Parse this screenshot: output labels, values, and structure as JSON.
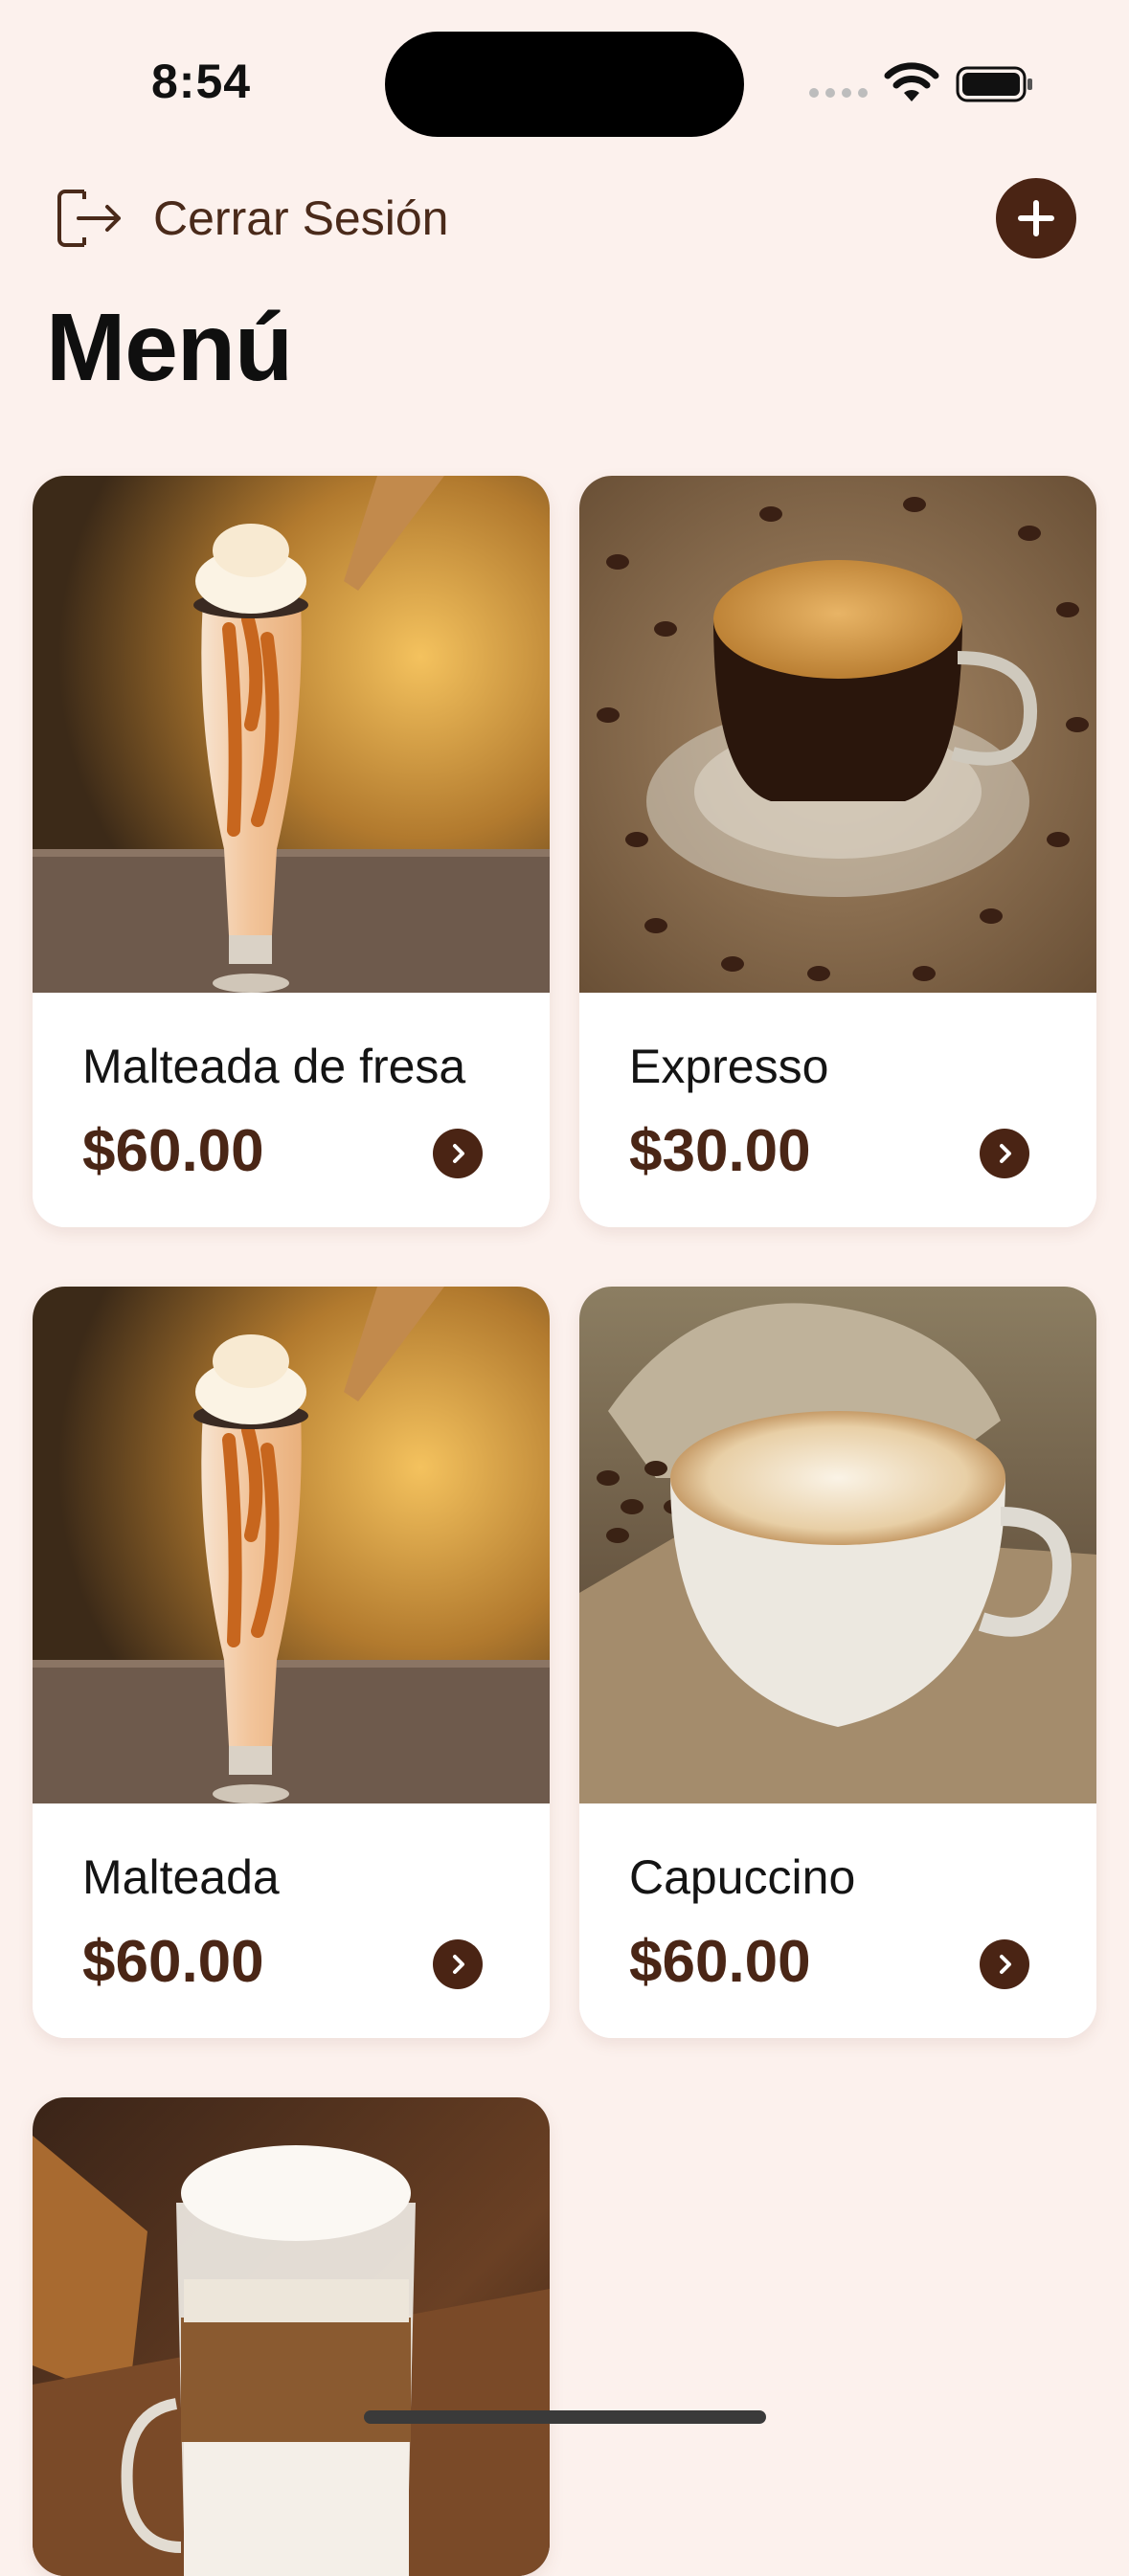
{
  "status_bar": {
    "time": "8:54"
  },
  "header": {
    "logout_label": "Cerrar Sesión",
    "title": "Menú"
  },
  "menu_items": [
    {
      "name": "Malteada de fresa",
      "price": "$60.00",
      "image": "milkshake-image"
    },
    {
      "name": "Expresso",
      "price": "$30.00",
      "image": "espresso-image"
    },
    {
      "name": "Malteada",
      "price": "$60.00",
      "image": "milkshake-image"
    },
    {
      "name": "Capuccino",
      "price": "$60.00",
      "image": "cappuccino-image"
    },
    {
      "name": "",
      "price": "",
      "image": "latte-macchiato-image"
    }
  ],
  "colors": {
    "background": "#FCF1ED",
    "accent": "#4A2414",
    "card": "#FFFFFF"
  }
}
